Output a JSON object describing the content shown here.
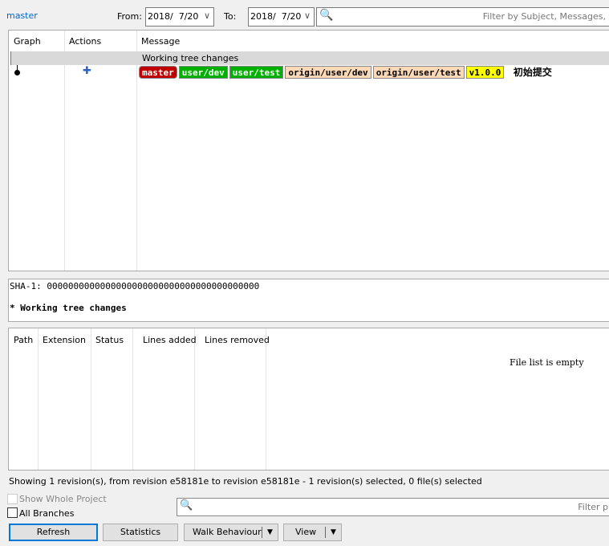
{
  "branch": "master",
  "filter_bar": {
    "from_label": "From:",
    "from_value": "2018/  7/20",
    "to_label": "To:",
    "to_value": "2018/  7/20",
    "filter_placeholder": "Filter by Subject, Messages,"
  },
  "log": {
    "columns": [
      "Graph",
      "Actions",
      "Message"
    ],
    "rows": [
      {
        "message": "Working tree changes"
      },
      {
        "tags": [
          {
            "text": "master",
            "bg": "#c00000",
            "fg": "#ffffff"
          },
          {
            "text": "user/dev",
            "bg": "#00b000",
            "fg": "#ffffff"
          },
          {
            "text": "user/test",
            "bg": "#00b000",
            "fg": "#ffffff"
          },
          {
            "text": "origin/user/dev",
            "bg": "#fcd9b6",
            "fg": "#000000"
          },
          {
            "text": "origin/user/test",
            "bg": "#fcd9b6",
            "fg": "#000000"
          },
          {
            "text": "v1.0.0",
            "bg": "#ffff00",
            "fg": "#000000"
          }
        ],
        "message": "初始提交"
      }
    ]
  },
  "details": {
    "sha": "SHA-1: 0000000000000000000000000000000000000000",
    "subject": "* Working tree changes"
  },
  "files": {
    "columns": [
      "Path",
      "Extension",
      "Status",
      "Lines added",
      "Lines removed"
    ],
    "empty": "File list is empty"
  },
  "status": "Showing 1 revision(s), from revision e58181e to revision e58181e - 1 revision(s) selected, 0 file(s) selected",
  "options": {
    "show_whole_project": "Show Whole Project",
    "all_branches": "All Branches",
    "filter_placeholder": "Filter p"
  },
  "buttons": {
    "refresh": "Refresh",
    "statistics": "Statistics",
    "walk": "Walk Behaviour",
    "view": "View"
  }
}
